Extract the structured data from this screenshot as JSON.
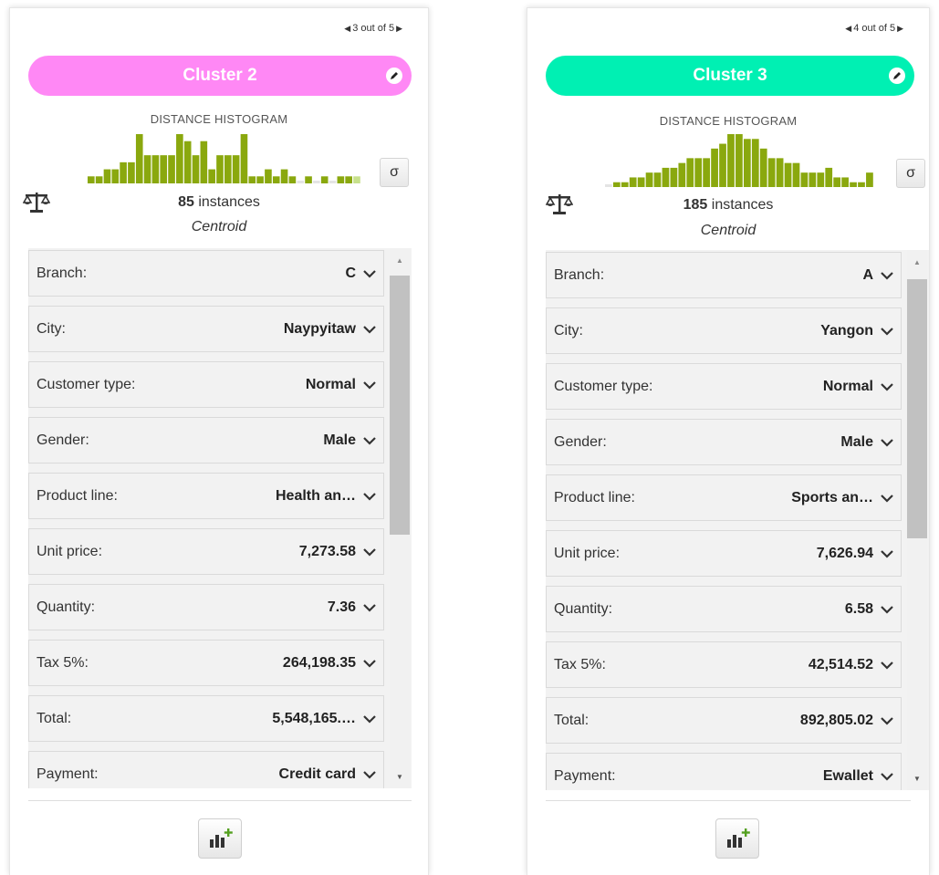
{
  "colors": {
    "cluster2": "#ff88f5",
    "cluster3": "#00f0b3",
    "histogram_dark": "#8aa80e",
    "histogram_light": "#c7e08c",
    "plus_green": "#54a020"
  },
  "icons": [
    "prev-arrow-icon",
    "next-arrow-icon",
    "pencil-icon",
    "sigma-icon",
    "scale-icon",
    "chevron-down-icon",
    "add-chart-icon"
  ],
  "panels": [
    {
      "pager": {
        "prev": "◀",
        "text": "3 out of 5",
        "next": "▶"
      },
      "cluster_name": "Cluster 2",
      "histogram_title": "DISTANCE HISTOGRAM",
      "histogram_bars": [
        1,
        1,
        2,
        2,
        3,
        3,
        7,
        4,
        4,
        4,
        4,
        7,
        6,
        4,
        6,
        2,
        4,
        4,
        4,
        7,
        1,
        1,
        2,
        1,
        2,
        1,
        0,
        1,
        0,
        1,
        0,
        1,
        1,
        1
      ],
      "sigma_label": "σ",
      "instances_count": "85",
      "instances_text": "instances",
      "centroid_label": "Centroid",
      "fields": [
        {
          "label": "Branch:",
          "value": "C"
        },
        {
          "label": "City:",
          "value": "Naypyitaw"
        },
        {
          "label": "Customer type:",
          "value": "Normal"
        },
        {
          "label": "Gender:",
          "value": "Male"
        },
        {
          "label": "Product line:",
          "value": "Health an…"
        },
        {
          "label": "Unit price:",
          "value": "7,273.58"
        },
        {
          "label": "Quantity:",
          "value": "7.36"
        },
        {
          "label": "Tax 5%:",
          "value": "264,198.35"
        },
        {
          "label": "Total:",
          "value": "5,548,165.…"
        },
        {
          "label": "Payment:",
          "value": "Credit card"
        }
      ],
      "scroll_up": "▲",
      "scroll_down": "▼"
    },
    {
      "pager": {
        "prev": "◀",
        "text": "4 out of 5",
        "next": "▶"
      },
      "cluster_name": "Cluster 3",
      "histogram_title": "DISTANCE HISTOGRAM",
      "histogram_bars": [
        0,
        1,
        1,
        2,
        2,
        3,
        3,
        4,
        4,
        5,
        6,
        6,
        6,
        8,
        9,
        11,
        11,
        10,
        10,
        8,
        6,
        6,
        5,
        5,
        3,
        3,
        3,
        4,
        2,
        2,
        1,
        1,
        3
      ],
      "sigma_label": "σ",
      "instances_count": "185",
      "instances_text": "instances",
      "centroid_label": "Centroid",
      "fields": [
        {
          "label": "Branch:",
          "value": "A"
        },
        {
          "label": "City:",
          "value": "Yangon"
        },
        {
          "label": "Customer type:",
          "value": "Normal"
        },
        {
          "label": "Gender:",
          "value": "Male"
        },
        {
          "label": "Product line:",
          "value": "Sports an…"
        },
        {
          "label": "Unit price:",
          "value": "7,626.94"
        },
        {
          "label": "Quantity:",
          "value": "6.58"
        },
        {
          "label": "Tax 5%:",
          "value": "42,514.52"
        },
        {
          "label": "Total:",
          "value": "892,805.02"
        },
        {
          "label": "Payment:",
          "value": "Ewallet"
        }
      ],
      "scroll_up": "▲",
      "scroll_down": "▼"
    }
  ]
}
